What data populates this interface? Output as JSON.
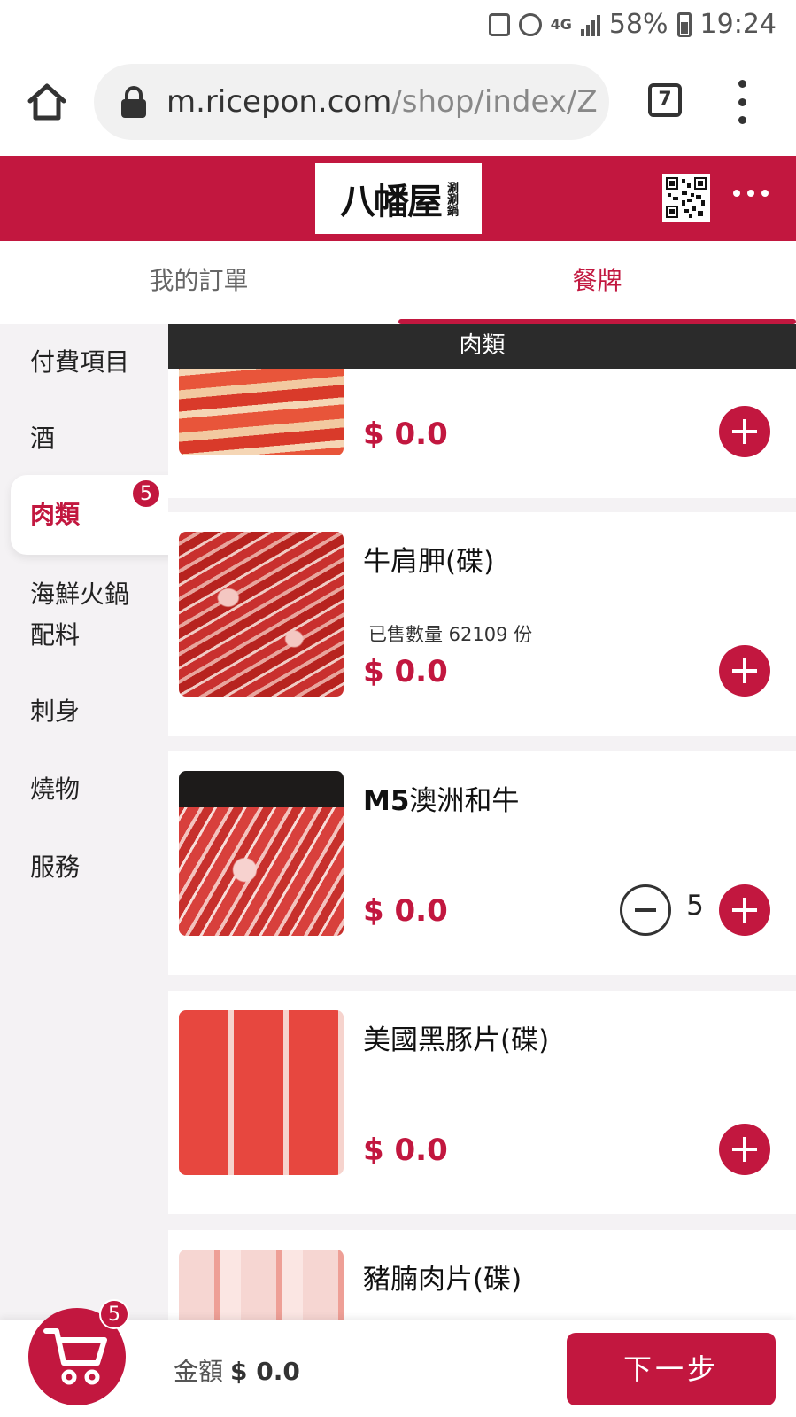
{
  "status_bar": {
    "network": "4G",
    "battery": "58%",
    "time": "19:24",
    "icons": [
      "notification-icon",
      "alarm-icon",
      "signal-icon",
      "battery-icon"
    ]
  },
  "browser": {
    "url_host": "m.ricepon.com",
    "url_path": "/shop/index/Z",
    "tab_count": "7",
    "icons": [
      "home-icon",
      "lock-icon",
      "tabs-icon",
      "kebab-menu-icon"
    ]
  },
  "header": {
    "brand_name": "八幡屋",
    "brand_side": "涮涮鍋",
    "icons": [
      "qr-code-icon",
      "more-icon"
    ],
    "accent_color": "#c2173f"
  },
  "tabs": [
    {
      "label": "我的訂單",
      "active": false
    },
    {
      "label": "餐牌",
      "active": true
    }
  ],
  "sidebar": {
    "items": [
      {
        "label": "付費項目",
        "active": false
      },
      {
        "label": "酒",
        "active": false
      },
      {
        "label": "肉類",
        "active": true,
        "badge": "5"
      },
      {
        "label": "海鮮火鍋配料",
        "active": false
      },
      {
        "label": "刺身",
        "active": false
      },
      {
        "label": "燒物",
        "active": false
      },
      {
        "label": "服務",
        "active": false
      }
    ]
  },
  "content": {
    "section_title": "肉類",
    "products": [
      {
        "name_bold": "",
        "name": "",
        "sold": "",
        "price": "$ 0.0",
        "qty": ""
      },
      {
        "name_bold": "",
        "name": "牛肩胛(碟)",
        "sold": "已售數量 62109 份",
        "price": "$ 0.0",
        "qty": ""
      },
      {
        "name_bold": "M5",
        "name": "澳洲和牛",
        "sold": "",
        "price": "$ 0.0",
        "qty": "5"
      },
      {
        "name_bold": "",
        "name": "美國黑豚片(碟)",
        "sold": "",
        "price": "$ 0.0",
        "qty": ""
      },
      {
        "name_bold": "",
        "name": "豬腩肉片(碟)",
        "sold": "",
        "price": "",
        "qty": ""
      }
    ]
  },
  "bottom": {
    "cart_badge": "5",
    "amount_label": "金額",
    "amount_value": "$ 0.0",
    "next_label": "下一步"
  }
}
